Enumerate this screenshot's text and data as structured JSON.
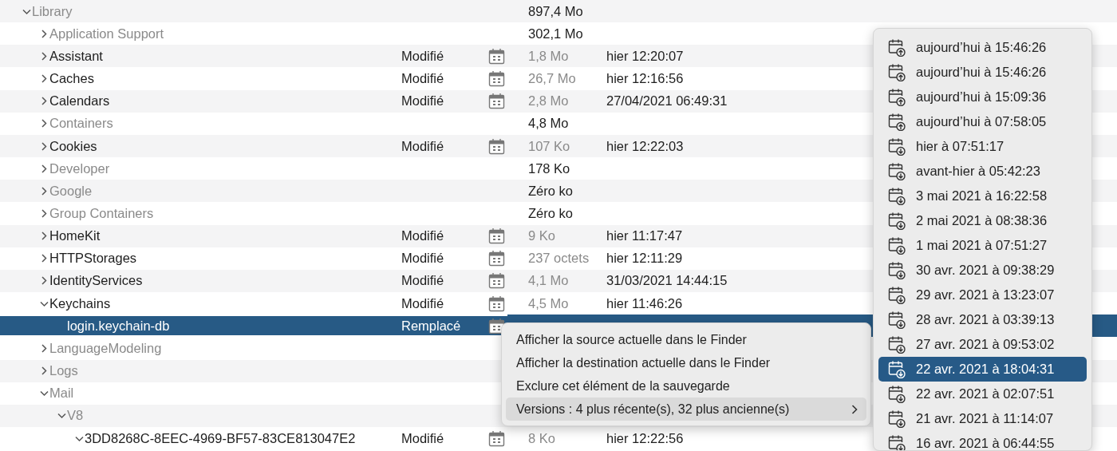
{
  "rows": [
    {
      "name": "Library",
      "size": "897,4 Mo",
      "expanded": true,
      "selected": false,
      "children": [
        {
          "name": "Application Support",
          "size": "302,1 Mo",
          "expanded": false,
          "selected": false
        },
        {
          "name": "Assistant",
          "status": "Modifié",
          "size": "1,8 Mo",
          "date": "hier 12:20:07",
          "expanded": false,
          "selected": false
        },
        {
          "name": "Caches",
          "status": "Modifié",
          "size": "26,7 Mo",
          "date": "hier 12:16:56",
          "expanded": false,
          "selected": false
        },
        {
          "name": "Calendars",
          "status": "Modifié",
          "size": "2,8 Mo",
          "date": "27/04/2021 06:49:31",
          "expanded": false,
          "selected": false
        },
        {
          "name": "Containers",
          "size": "4,8 Mo",
          "expanded": false,
          "selected": false
        },
        {
          "name": "Cookies",
          "status": "Modifié",
          "size": "107 Ko",
          "date": "hier 12:22:03",
          "expanded": false,
          "selected": false
        },
        {
          "name": "Developer",
          "size": "178 Ko",
          "expanded": false,
          "selected": false
        },
        {
          "name": "Google",
          "size": "Zéro ko",
          "expanded": false,
          "selected": false
        },
        {
          "name": "Group Containers",
          "size": "Zéro ko",
          "expanded": false,
          "selected": false
        },
        {
          "name": "HomeKit",
          "status": "Modifié",
          "size": "9 Ko",
          "date": "hier 11:17:47",
          "expanded": false,
          "selected": false
        },
        {
          "name": "HTTPStorages",
          "status": "Modifié",
          "size": "237 octets",
          "date": "hier 12:11:29",
          "expanded": false,
          "selected": false
        },
        {
          "name": "IdentityServices",
          "status": "Modifié",
          "size": "4,1 Mo",
          "date": "31/03/2021 14:44:15",
          "expanded": false,
          "selected": false
        },
        {
          "name": "Keychains",
          "status": "Modifié",
          "size": "4,5 Mo",
          "date": "hier 11:46:26",
          "expanded": true,
          "selected": false,
          "children": [
            {
              "name": "login.keychain-db",
              "status": "Remplacé",
              "selected": true
            }
          ]
        },
        {
          "name": "LanguageModeling",
          "expanded": false,
          "selected": false
        },
        {
          "name": "Logs",
          "expanded": false,
          "selected": false
        },
        {
          "name": "Mail",
          "expanded": true,
          "selected": false,
          "children": [
            {
              "name": "V8",
              "expanded": true,
              "selected": false,
              "children": [
                {
                  "name": "3DD8268C-8EEC-4969-BF57-83CE813047E2",
                  "status": "Modifié",
                  "size": "8 Ko",
                  "date": "hier 12:22:56",
                  "expanded": true,
                  "selected": false
                }
              ]
            }
          ]
        }
      ]
    }
  ],
  "context_menu": [
    {
      "label": "Afficher la source actuelle dans le Finder",
      "selected": false
    },
    {
      "label": "Afficher la destination actuelle dans le Finder",
      "selected": false
    },
    {
      "label": "Exclure cet élément de la sauvegarde",
      "selected": false
    },
    {
      "label": "Versions : 4 plus récente(s), 32 plus ancienne(s)",
      "selected": true,
      "submenu": true
    }
  ],
  "versions_menu": [
    {
      "label": "aujourd’hui à 15:46:26",
      "kind": "newer",
      "selected": false
    },
    {
      "label": "aujourd’hui à 15:46:26",
      "kind": "newer",
      "selected": false
    },
    {
      "label": "aujourd’hui à 15:09:36",
      "kind": "newer",
      "selected": false
    },
    {
      "label": "aujourd’hui à 07:58:05",
      "kind": "newer",
      "selected": false
    },
    {
      "label": "hier à 07:51:17",
      "kind": "older",
      "selected": false
    },
    {
      "label": "avant-hier à 05:42:23",
      "kind": "older",
      "selected": false
    },
    {
      "label": "3 mai 2021 à 16:22:58",
      "kind": "older",
      "selected": false
    },
    {
      "label": "2 mai 2021 à 08:38:36",
      "kind": "older",
      "selected": false
    },
    {
      "label": "1 mai 2021 à 07:51:27",
      "kind": "older",
      "selected": false
    },
    {
      "label": "30 avr. 2021 à 09:38:29",
      "kind": "older",
      "selected": false
    },
    {
      "label": "29 avr. 2021 à 13:23:07",
      "kind": "older",
      "selected": false
    },
    {
      "label": "28 avr. 2021 à 03:39:13",
      "kind": "older",
      "selected": false
    },
    {
      "label": "27 avr. 2021 à 09:53:02",
      "kind": "older",
      "selected": false
    },
    {
      "label": "22 avr. 2021 à 18:04:31",
      "kind": "older",
      "selected": true
    },
    {
      "label": "22 avr. 2021 à 02:07:51",
      "kind": "older",
      "selected": false
    },
    {
      "label": "21 avr. 2021 à 11:14:07",
      "kind": "older",
      "selected": false
    },
    {
      "label": "16 avr. 2021 à 06:44:55",
      "kind": "older",
      "selected": false
    }
  ]
}
